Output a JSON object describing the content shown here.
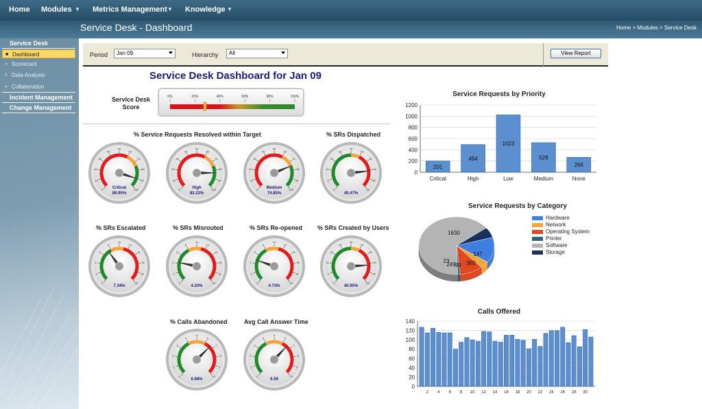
{
  "nav": {
    "items": [
      {
        "label": "Home",
        "caret": false
      },
      {
        "label": "Modules",
        "caret": true
      },
      {
        "label": "Metrics Management",
        "caret": true
      },
      {
        "label": "Knowledge",
        "caret": true
      }
    ]
  },
  "header": {
    "title": "Service Desk - Dashboard",
    "breadcrumb": [
      "Home",
      "Modules",
      "Service Desk"
    ],
    "breadcrumb_sep": ">"
  },
  "sidebar": {
    "section": "Service Desk",
    "items": [
      {
        "label": "Dashboard",
        "active": true
      },
      {
        "label": "Scorecard",
        "active": false
      },
      {
        "label": "Data Analysis",
        "active": false
      },
      {
        "label": "Collaboration",
        "active": false
      }
    ],
    "sections2": [
      "Incident Management",
      "Change Management"
    ]
  },
  "filters": {
    "period_label": "Period",
    "period_value": "Jan 09",
    "hierarchy_label": "Hierarchy",
    "hierarchy_value": "All",
    "view_button": "View Report"
  },
  "dashboard": {
    "title": "Service Desk Dashboard for Jan 09",
    "score_label": "Service Desk Score",
    "score_ticks": [
      "0%",
      "20%",
      "40%",
      "60%",
      "80%",
      "100%"
    ],
    "score_value": 0.28
  },
  "gauges": {
    "group_title": "% Service Requests Resolved within Target",
    "items": [
      {
        "name": "critical",
        "title": "",
        "cap1": "Critical",
        "cap2": "89.95%",
        "value": 89.95,
        "scale": "pct_high_good"
      },
      {
        "name": "high",
        "title": "",
        "cap1": "High",
        "cap2": "83.23%",
        "value": 83.23,
        "scale": "pct_high_good"
      },
      {
        "name": "medium",
        "title": "",
        "cap1": "Medium",
        "cap2": "74.85%",
        "value": 74.85,
        "scale": "pct_high_good"
      },
      {
        "name": "dispatched",
        "title": "% SRs Dispatched",
        "cap1": "",
        "cap2": "40.47%",
        "value": 40.47,
        "scale": "fifty_high_good"
      },
      {
        "name": "escalated",
        "title": "% SRs Escalated",
        "cap1": "",
        "cap2": "7.34%",
        "value": 7.34,
        "scale": "twenty_low_good"
      },
      {
        "name": "misrouted",
        "title": "% SRs Misrouted",
        "cap1": "",
        "cap2": "4.20%",
        "value": 4.2,
        "scale": "twenty_low_good"
      },
      {
        "name": "reopened",
        "title": "% SRs Re-opened",
        "cap1": "",
        "cap2": "4.73%",
        "value": 4.73,
        "scale": "twenty_low_good"
      },
      {
        "name": "created-by-users",
        "title": "% SRs Created by Users",
        "cap1": "",
        "cap2": "40.95%",
        "value": 40.95,
        "scale": "fifty_high_good"
      },
      {
        "name": "calls-abandoned",
        "title": "% Calls Abandoned",
        "cap1": "",
        "cap2": "6.68%",
        "value": 6.68,
        "scale": "ten_low_good"
      },
      {
        "name": "avg-answer-time",
        "title": "Avg Call Answer Time",
        "cap1": "",
        "cap2": "6.59",
        "value": 6.59,
        "scale": "ten_low_good"
      }
    ],
    "scales": {
      "pct_high_good": {
        "min": 0,
        "max": 100,
        "ticks": [
          "0",
          "10",
          "20",
          "30",
          "40",
          "50",
          "60",
          "70",
          "80",
          "90",
          "100"
        ],
        "bands": [
          {
            "from": 0,
            "to": 60,
            "color": "#e41b1b"
          },
          {
            "from": 60,
            "to": 75,
            "color": "#f3a43a"
          },
          {
            "from": 75,
            "to": 100,
            "color": "#1f8a2a"
          }
        ]
      },
      "fifty_high_good": {
        "min": 0,
        "max": 50,
        "ticks": [
          "0",
          "5",
          "10",
          "15",
          "20",
          "25",
          "30",
          "35",
          "40",
          "45",
          "50"
        ],
        "bands": [
          {
            "from": 0,
            "to": 25,
            "color": "#1f8a2a"
          },
          {
            "from": 25,
            "to": 30,
            "color": "#f3a43a"
          },
          {
            "from": 30,
            "to": 50,
            "color": "#e41b1b"
          }
        ]
      },
      "twenty_low_good": {
        "min": 0,
        "max": 20,
        "ticks": [
          "0",
          "2",
          "4",
          "6",
          "8",
          "10",
          "12",
          "14",
          "16",
          "18",
          "20"
        ],
        "bands": [
          {
            "from": 0,
            "to": 8,
            "color": "#1f8a2a"
          },
          {
            "from": 8,
            "to": 11,
            "color": "#f3a43a"
          },
          {
            "from": 11,
            "to": 20,
            "color": "#e41b1b"
          }
        ]
      },
      "ten_low_good": {
        "min": 0,
        "max": 10,
        "ticks": [
          "0",
          "1",
          "2",
          "3",
          "4",
          "5",
          "6",
          "7",
          "8",
          "9",
          "10"
        ],
        "bands": [
          {
            "from": 0,
            "to": 4,
            "color": "#1f8a2a"
          },
          {
            "from": 4,
            "to": 6,
            "color": "#f3a43a"
          },
          {
            "from": 6,
            "to": 10,
            "color": "#e41b1b"
          }
        ]
      }
    }
  },
  "chart_data": [
    {
      "type": "bar",
      "title": "Service Requests by Priority",
      "categories": [
        "Critical",
        "High",
        "Low",
        "Medium",
        "None"
      ],
      "values": [
        201,
        494,
        1023,
        528,
        266
      ],
      "data_labels": [
        "201",
        "494",
        "1023",
        "528",
        "266"
      ],
      "ylim": [
        0,
        1200
      ],
      "yticks": [
        "0",
        "200",
        "400",
        "600",
        "800",
        "1000",
        "1200"
      ],
      "grid": true,
      "color": "#5b8fd0"
    },
    {
      "type": "pie",
      "title": "Service Requests by Category",
      "categories": [
        "Hardware",
        "Network",
        "Operating System",
        "Printer",
        "Software",
        "Storage"
      ],
      "values": [
        360,
        99,
        249,
        23,
        1630,
        147
      ],
      "data_labels": [
        "360",
        "99",
        "249",
        "23",
        "1630",
        "147"
      ],
      "colors": [
        "#3d7fe0",
        "#f3a43a",
        "#e04820",
        "#2a6384",
        "#b4b4b4",
        "#1a2f5e"
      ],
      "legend": "right"
    },
    {
      "type": "bar",
      "title": "Calls Offered",
      "categories": [
        1,
        2,
        3,
        4,
        5,
        6,
        7,
        8,
        9,
        10,
        11,
        12,
        13,
        14,
        15,
        16,
        17,
        18,
        19,
        20,
        21,
        22,
        23,
        24,
        25,
        26,
        27,
        28,
        29,
        30,
        31
      ],
      "values": [
        127,
        115,
        125,
        116,
        115,
        115,
        80,
        95,
        105,
        100,
        97,
        118,
        117,
        97,
        95,
        110,
        110,
        101,
        99,
        81,
        101,
        86,
        114,
        120,
        120,
        127,
        94,
        109,
        85,
        122,
        106
      ],
      "ylim": [
        0,
        140
      ],
      "yticks": [
        "0",
        "20",
        "40",
        "60",
        "80",
        "100",
        "120",
        "140"
      ],
      "xticks": [
        "2",
        "4",
        "6",
        "8",
        "10",
        "12",
        "14",
        "16",
        "18",
        "20",
        "22",
        "24",
        "26",
        "28",
        "30"
      ],
      "grid": true,
      "color": "#5b8fd0"
    }
  ]
}
